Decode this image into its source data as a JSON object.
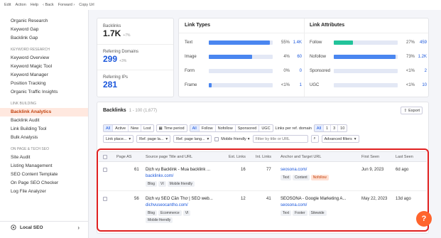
{
  "menubar": {
    "items": [
      "Edit",
      "Action",
      "Help",
      "‹ Back",
      "Forward ›",
      "Copy Url"
    ]
  },
  "sidebar": {
    "items": [
      "Organic Research",
      "Keyword Gap",
      "Backlink Gap"
    ],
    "sec1_head": "KEYWORD RESEARCH",
    "sec1": [
      "Keyword Overview",
      "Keyword Magic Tool",
      "Keyword Manager",
      "Position Tracking",
      "Organic Traffic Insights"
    ],
    "sec2_head": "LINK BUILDING",
    "sec2": [
      "Backlink Analytics",
      "Backlink Audit",
      "Link Building Tool",
      "Bulk Analysis"
    ],
    "sec3_head": "ON PAGE & TECH SEO",
    "sec3": [
      "Site Audit",
      "Listing Management",
      "SEO Content Template",
      "On Page SEO Checker",
      "Log File Analyzer"
    ],
    "bottom": "Local SEO"
  },
  "metrics": {
    "backlinks_label": "Backlinks",
    "backlinks_value": "1.7K",
    "backlinks_delta": "+7%",
    "ref_domains_label": "Referring Domains",
    "ref_domains_value": "299",
    "ref_domains_delta": "+3%",
    "ref_ips_label": "Referring IPs",
    "ref_ips_value": "281"
  },
  "link_types": {
    "title": "Link Types",
    "rows": [
      {
        "name": "Text",
        "pct": "55%",
        "num": "1.4K",
        "fill": 0.96
      },
      {
        "name": "Image",
        "pct": "4%",
        "num": "60",
        "fill": 0.68
      },
      {
        "name": "Form",
        "pct": "0%",
        "num": "0",
        "fill": 0
      },
      {
        "name": "Frame",
        "pct": "<1%",
        "num": "1",
        "fill": 0.04
      }
    ]
  },
  "link_attributes": {
    "title": "Link Attributes",
    "rows": [
      {
        "name": "Follow",
        "pct": "27%",
        "num": "459",
        "fill": 0.3,
        "color": "#22c39a"
      },
      {
        "name": "Nofollow",
        "pct": "73%",
        "num": "1.2K",
        "fill": 0.97,
        "color": "#4a86f0"
      },
      {
        "name": "Sponsored",
        "pct": "<1%",
        "num": "2",
        "fill": 0.0,
        "color": "#4a86f0"
      },
      {
        "name": "UGC",
        "pct": "<1%",
        "num": "10",
        "fill": 0.0,
        "color": "#4a86f0"
      }
    ]
  },
  "backlinks": {
    "title": "Backlinks",
    "range": "1 - 100 (1,677)",
    "export_label": "Export",
    "type_filters": [
      "All",
      "Active",
      "New",
      "Lost"
    ],
    "time_period": "Time period",
    "attr_filters": [
      "All",
      "Follow",
      "Nofollow",
      "Sponsored",
      "UGC"
    ],
    "per_domain_label": "Links per ref. domain",
    "per_domain": [
      "All",
      "1",
      "3",
      "10"
    ],
    "dropdowns": [
      "Link place...",
      "Ref. page la...",
      "Ref. page lang...",
      "Mobile friendly",
      "Advanced filters"
    ],
    "search_placeholder": "Filter by title or URL",
    "columns": [
      "Page AS",
      "Source page Title and URL",
      "Ext. Links",
      "Int. Links",
      "Anchor and Target URL",
      "First Seen",
      "Last Seen"
    ],
    "rows": [
      {
        "as": "61",
        "title": "Dịch vụ Backlink - Mua backlink ...",
        "url": "backlinkx.com/",
        "tags": [
          "Blog",
          "VI",
          "Mobile friendly"
        ],
        "ext": "16",
        "int": "77",
        "anchor": "seosona.com/",
        "anchor_tags": [
          "Text",
          "Content",
          "Nofollow"
        ],
        "first": "Jun 9, 2023",
        "last": "6d ago"
      },
      {
        "as": "56",
        "title": "Dịch vụ SEO Cần Thơ | SEO web...",
        "url": "dichvuseocantho.com/",
        "tags": [
          "Blog",
          "Ecommerce",
          "VI",
          "Mobile friendly"
        ],
        "ext": "12",
        "int": "41",
        "anchor_title": "SEOSONA - Google Marketing A...",
        "anchor": "seosona.com/",
        "anchor_tags": [
          "Text",
          "Footer",
          "Sitewide"
        ],
        "first": "May 22, 2023",
        "last": "13d ago"
      }
    ]
  },
  "help_label": "?"
}
